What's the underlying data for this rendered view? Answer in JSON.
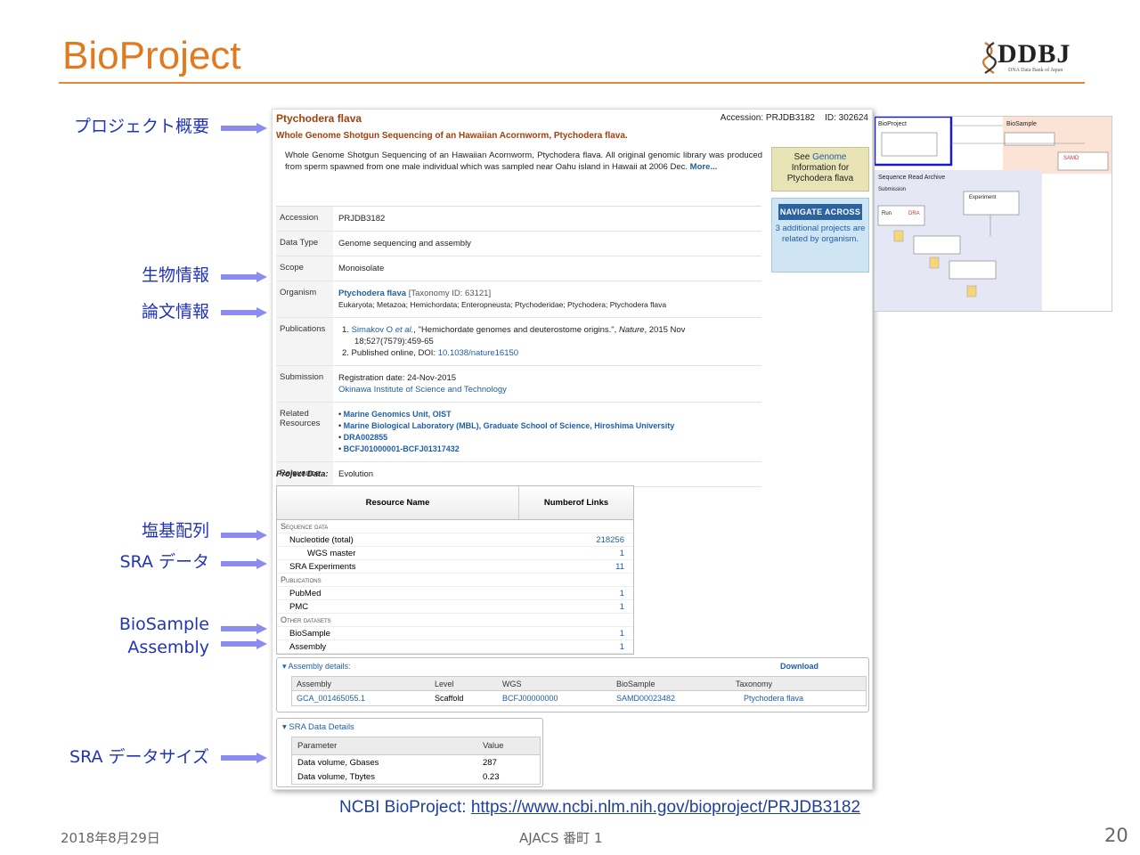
{
  "slide": {
    "title": "BioProject",
    "logo_text": "DDBJ",
    "logo_sub": "DNA Data Bank of Japan",
    "footer_date": "2018年8月29日",
    "footer_center": "AJACS 番町 1",
    "page_number": "20",
    "source_prefix": "NCBI BioProject: ",
    "source_url": "https://www.ncbi.nlm.nih.gov/bioproject/PRJDB3182"
  },
  "labels": {
    "overview": "プロジェクト概要",
    "organism": "生物情報",
    "publications": "論文情報",
    "sequence": "塩基配列",
    "sra": "SRA データ",
    "biosample": "BioSample",
    "assembly": "Assembly",
    "sra_size": "SRA データサイズ"
  },
  "colors": {
    "title": "#e07a1f",
    "label": "#2233bb",
    "arrow": "#8c8cf0",
    "link": "#1f5fa8"
  },
  "page": {
    "organism_title": "Ptychodera flava",
    "accession_top": "Accession: PRJDB3182    ID: 302624",
    "full_title": "Whole Genome Shotgun Sequencing of an Hawaiian Acornworm, Ptychodera flava.",
    "description": "Whole Genome Shotgun Sequencing of an Hawaiian Acornworm, Ptychodera flava. All original genomic library was produced from sperm spawned from one male individual which was sampled near Oahu island in Hawaii at 2006 Dec.",
    "more": "More...",
    "side_genome_a": "See ",
    "side_genome_link": "Genome",
    "side_genome_b": "Information for",
    "side_genome_c": "Ptychodera flava",
    "nav_button": "NAVIGATE ACROSS",
    "nav_text": "3 additional projects are related by organism.",
    "info": {
      "accession_k": "Accession",
      "accession_v": "PRJDB3182",
      "datatype_k": "Data Type",
      "datatype_v": "Genome sequencing and assembly",
      "scope_k": "Scope",
      "scope_v": "Monoisolate",
      "organism_k": "Organism",
      "organism_link": "Ptychodera flava",
      "organism_taxid": "[Taxonomy ID: 63121]",
      "organism_lineage": "Eukaryota; Metazoa; Hemichordata; Enteropneusta; Ptychoderidae; Ptychodera; Ptychodera flava",
      "pub_k": "Publications",
      "pub1_num": "1.",
      "pub1_author": "Simakov O",
      "pub1_etal": "et al.",
      "pub1_rest": ", \"Hemichordate genomes and deuterostome origins.\",",
      "pub1_journal": "Nature",
      "pub1_year": ", 2015 Nov",
      "pub1_cont": "18;527(7579):459-65",
      "pub2_pre": "2. Published online, DOI: ",
      "pub2_doi": "10.1038/nature16150",
      "sub_k": "Submission",
      "sub_date": "Registration date: 24-Nov-2015",
      "sub_inst": "Okinawa Institute of Science and Technology",
      "rel_k1": "Related",
      "rel_k2": "Resources",
      "rel1": "Marine Genomics Unit, OIST",
      "rel2": "Marine Biological Laboratory (MBL), Graduate School of Science, Hiroshima University",
      "rel3": "DRA002855",
      "rel4": "BCFJ01000001-BCFJ01317432",
      "relevance_k": "Relevance",
      "relevance_v": "Evolution"
    },
    "project_data_label": "Project Data:",
    "resource": {
      "head_name": "Resource Name",
      "head_links_1": "Number",
      "head_links_2": "of Links",
      "sec1": "Sequence data",
      "r1_name": "Nucleotide (total)",
      "r1_val": "218256",
      "r2_name": "WGS master",
      "r2_val": "1",
      "r3_name": "SRA Experiments",
      "r3_val": "11",
      "sec2": "Publications",
      "r4_name": "PubMed",
      "r4_val": "1",
      "r5_name": "PMC",
      "r5_val": "1",
      "sec3": "Other datasets",
      "r6_name": "BioSample",
      "r6_val": "1",
      "r7_name": "Assembly",
      "r7_val": "1"
    },
    "assembly": {
      "header": "▾ Assembly details:",
      "download": "Download",
      "cols": [
        "Assembly",
        "Level",
        "WGS",
        "BioSample",
        "Taxonomy"
      ],
      "row": [
        "GCA_001465055.1",
        "Scaffold",
        "BCFJ00000000",
        "SAMD00023482",
        "Ptychodera flava"
      ]
    },
    "sra_details": {
      "header": "▾ SRA Data Details",
      "col_param": "Parameter",
      "col_value": "Value",
      "r1_param": "Data volume, Gbases",
      "r1_val": "287",
      "r2_param": "Data volume, Tbytes",
      "r2_val": "0.23"
    }
  },
  "thumbnail": {
    "bioproject": "BioProject",
    "biosample": "BioSample",
    "sra": "Sequence Read Archive",
    "submission": "Submission",
    "experiment": "Experiment",
    "run": "Run",
    "dra": "DRA",
    "samd": "SAMD"
  }
}
